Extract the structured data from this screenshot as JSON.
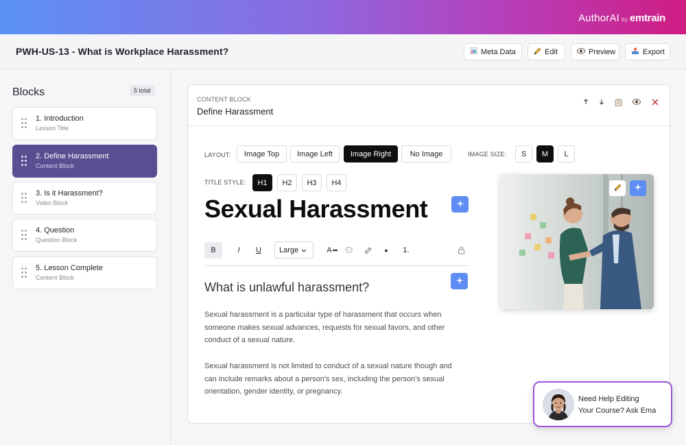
{
  "brand": {
    "name": "AuthorAI",
    "by": "by",
    "company": "emtrain"
  },
  "header": {
    "title": "PWH-US-13 - What is Workplace Harassment?",
    "buttons": [
      {
        "label": "Meta Data",
        "icon": "bar-chart-icon"
      },
      {
        "label": "Edit",
        "icon": "pencil-icon"
      },
      {
        "label": "Preview",
        "icon": "eye-icon"
      },
      {
        "label": "Export",
        "icon": "export-icon"
      }
    ]
  },
  "sidebar": {
    "title": "Blocks",
    "count": "5 total",
    "items": [
      {
        "title": "1. Introduction",
        "subtitle": "Lesson Title",
        "active": false
      },
      {
        "title": "2. Define Harassment",
        "subtitle": "Content Block",
        "active": true
      },
      {
        "title": "3. Is it Harassment?",
        "subtitle": "Video Block",
        "active": false
      },
      {
        "title": "4. Question",
        "subtitle": "Question Block",
        "active": false
      },
      {
        "title": "5. Lesson Complete",
        "subtitle": "Content Block",
        "active": false
      }
    ]
  },
  "editor": {
    "kicker": "CONTENT BLOCK",
    "block_title": "Define Harassment",
    "controls": [
      "arrow-up-icon",
      "arrow-down-icon",
      "copy-icon",
      "eye-icon",
      "close-icon"
    ],
    "layout": {
      "label": "LAYOUT:",
      "options": [
        "Image Top",
        "Image Left",
        "Image Right",
        "No Image"
      ],
      "selected": "Image Right"
    },
    "image_size": {
      "label": "IMAGE SIZE:",
      "options": [
        "S",
        "M",
        "L"
      ],
      "selected": "M"
    },
    "title_style": {
      "label": "TITLE STYLE:",
      "options": [
        "H1",
        "H2",
        "H3",
        "H4"
      ],
      "selected": "H1"
    },
    "title": "Sexual Harassment",
    "toolbar": {
      "bold": "B",
      "italic": "I",
      "underline": "U",
      "size": "Large",
      "text_color": "A",
      "numbered_list": "1."
    },
    "subheading": "What is unlawful harassment?",
    "paragraphs": [
      "Sexual harassment is a particular type of harassment that occurs when someone makes sexual advances, requests for sexual favors, and other conduct of a sexual nature.",
      "Sexual harassment is not limited to conduct of a sexual nature though and can include remarks about a person's sex, including the person's sexual orientation, gender identity, or pregnancy."
    ]
  },
  "help": {
    "line1": "Need Help Editing",
    "line2": "Your Course? Ask Ema"
  },
  "colors": {
    "accent": "#5b4d91",
    "ai_button": "#5e8ef3",
    "help_border": "#9b55d6"
  }
}
